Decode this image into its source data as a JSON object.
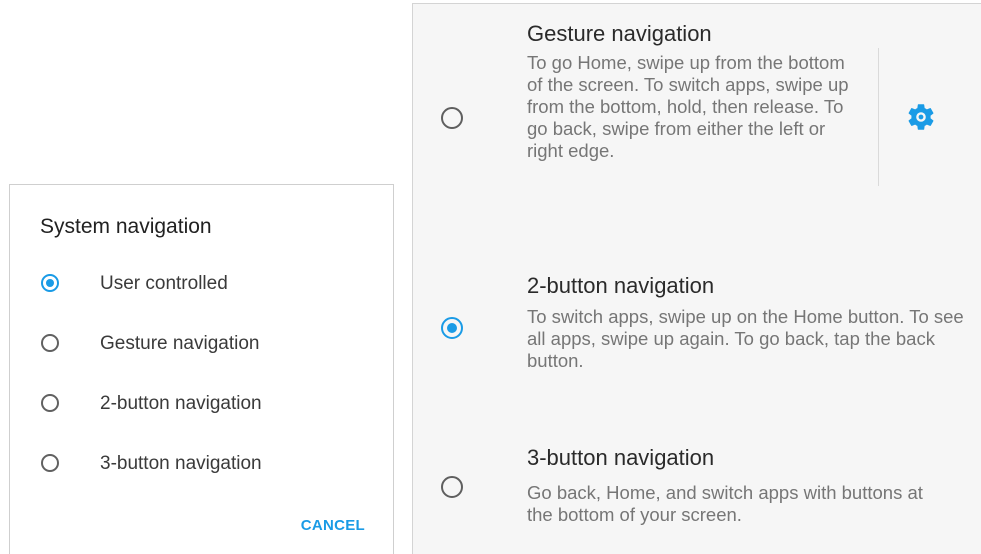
{
  "dialog": {
    "title": "System navigation",
    "options": [
      {
        "label": "User controlled",
        "checked": true
      },
      {
        "label": "Gesture navigation",
        "checked": false
      },
      {
        "label": "2-button navigation",
        "checked": false
      },
      {
        "label": "3-button navigation",
        "checked": false
      }
    ],
    "cancel_label": "CANCEL"
  },
  "panel": {
    "items": [
      {
        "title": "Gesture navigation",
        "summary": "To go Home, swipe up from the bottom of the screen. To switch apps, swipe up from the bottom, hold, then release. To go back, swipe from either the left or right edge.",
        "checked": false,
        "settings_icon": "gear-icon"
      },
      {
        "title": "2-button navigation",
        "summary": "To switch apps, swipe up on the Home button. To see all apps, swipe up again. To go back, tap the back button.",
        "checked": true
      },
      {
        "title": "3-button navigation",
        "summary": "Go back, Home, and switch apps with buttons at the bottom of your screen.",
        "checked": false
      }
    ]
  },
  "colors": {
    "accent": "#1a9be6",
    "panel_background": "#f6f6f6",
    "title_text": "#2a2a2a",
    "summary_text": "#767676"
  }
}
